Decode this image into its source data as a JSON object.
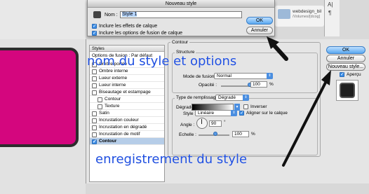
{
  "sheet": {
    "title": "Nouveau style",
    "name_label": "Nom :",
    "name_value": "Style 1",
    "include_effects_label": "Inclure les effets de calque",
    "include_effects_checked": true,
    "include_blend_label": "Inclure les options de fusion de calque",
    "include_blend_checked": true,
    "ok_label": "OK",
    "cancel_label": "Annuler"
  },
  "background": {
    "folder_name": "webdesign_bil",
    "folder_path": "/Volumes/[dcog]",
    "side_a": "A|",
    "side_b": "¶"
  },
  "styles_panel": {
    "header": "Styles",
    "options_label": "Options de fusion : Par défaut",
    "items": [
      {
        "label": "Ombre portée",
        "checked": false,
        "indent": false,
        "selected": false
      },
      {
        "label": "Ombre interne",
        "checked": false,
        "indent": false,
        "selected": false
      },
      {
        "label": "Lueur externe",
        "checked": false,
        "indent": false,
        "selected": false
      },
      {
        "label": "Lueur interne",
        "checked": false,
        "indent": false,
        "selected": false
      },
      {
        "label": "Biseautage et estampage",
        "checked": false,
        "indent": false,
        "selected": false
      },
      {
        "label": "Contour",
        "checked": false,
        "indent": true,
        "selected": false
      },
      {
        "label": "Texture",
        "checked": false,
        "indent": true,
        "selected": false
      },
      {
        "label": "Satin",
        "checked": false,
        "indent": false,
        "selected": false
      },
      {
        "label": "Incrustation couleur",
        "checked": false,
        "indent": false,
        "selected": false
      },
      {
        "label": "Incrustation en dégradé",
        "checked": false,
        "indent": false,
        "selected": false
      },
      {
        "label": "Incrustation de motif",
        "checked": false,
        "indent": false,
        "selected": false
      },
      {
        "label": "Contour",
        "checked": true,
        "indent": false,
        "selected": true
      }
    ]
  },
  "contour_panel": {
    "title": "Contour",
    "structure_title": "Structure",
    "blend_mode_label": "Mode de fusion :",
    "blend_mode_value": "Normal",
    "opacity_label": "Opacité :",
    "opacity_value": "100",
    "opacity_unit": "%",
    "opacity_fraction": 1.0,
    "fill_type_label": "Type de remplissage :",
    "fill_type_value": "Dégradé",
    "gradient_label": "Dégradé :",
    "invert_label": "Inverser",
    "invert_checked": false,
    "style_label": "Style :",
    "style_value": "Linéaire",
    "align_label": "Aligner sur le calque",
    "align_checked": true,
    "angle_label": "Angle :",
    "angle_value": "90",
    "angle_unit": "°",
    "scale_label": "Echelle :",
    "scale_value": "100",
    "scale_unit": "%"
  },
  "right_buttons": {
    "ok_label": "OK",
    "cancel_label": "Annuler",
    "new_style_label": "Nouveau style...",
    "preview_label": "Aperçu",
    "preview_checked": true
  },
  "annotations": {
    "name_note": "nom du style et options",
    "save_note": "enregistrement du style"
  },
  "colors": {
    "accent_blue": "#3b8de6",
    "annotation_blue": "#1f4fe0",
    "pink_shape": "#d4067e"
  }
}
